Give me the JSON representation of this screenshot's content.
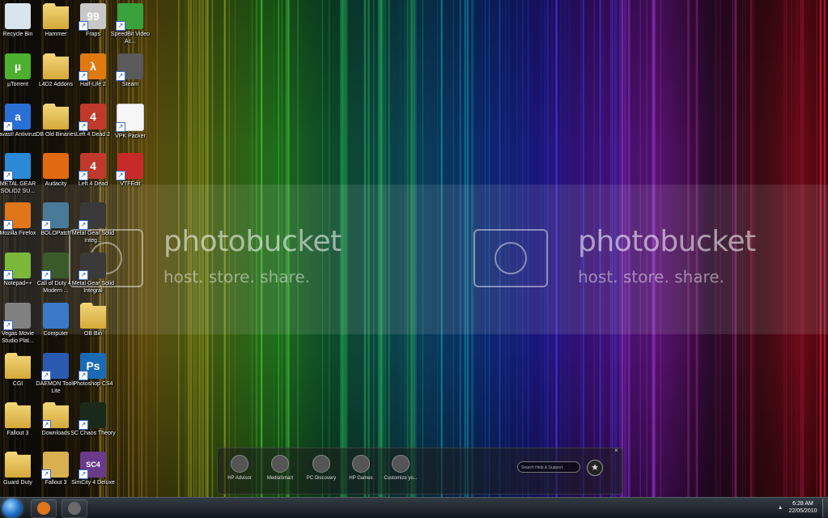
{
  "desktop": {
    "icons": [
      {
        "label": "Recycle Bin",
        "icon": "recycle-bin-icon",
        "color": "#d8e4ee",
        "shortcut": false
      },
      {
        "label": "Hammer",
        "icon": "folder-icon",
        "color": "#e8c25a",
        "shortcut": false
      },
      {
        "label": "Fraps",
        "icon": "fraps-icon",
        "color": "#c8c8c8",
        "shortcut": true,
        "glyph": "99"
      },
      {
        "label": "SpeedBit Video Ac...",
        "icon": "speedbit-icon",
        "color": "#3aa23a",
        "shortcut": true
      },
      {
        "label": "µTorrent",
        "icon": "utorrent-icon",
        "color": "#4caf2f",
        "shortcut": false,
        "glyph": "µ"
      },
      {
        "label": "L4D2 Addons",
        "icon": "folder-icon",
        "color": "#e8c25a",
        "shortcut": false
      },
      {
        "label": "Half-Life 2",
        "icon": "half-life-icon",
        "color": "#e07a10",
        "shortcut": true,
        "glyph": "λ"
      },
      {
        "label": "Steam",
        "icon": "steam-icon",
        "color": "#5a5a5a",
        "shortcut": true
      },
      {
        "label": "avast! Antivirus",
        "icon": "avast-icon",
        "color": "#2a6fd6",
        "shortcut": true,
        "glyph": "a"
      },
      {
        "label": "OB Old Binaries",
        "icon": "folder-icon",
        "color": "#e8c25a",
        "shortcut": false
      },
      {
        "label": "Left 4 Dead 2",
        "icon": "l4d2-icon",
        "color": "#c0392b",
        "shortcut": true,
        "glyph": "4"
      },
      {
        "label": "VPK Packer",
        "icon": "document-icon",
        "color": "#f4f4f4",
        "shortcut": true
      },
      {
        "label": "METAL GEAR SOLID2 SU...",
        "icon": "mgs2-icon",
        "color": "#2a8ad6",
        "shortcut": true
      },
      {
        "label": "Audacity",
        "icon": "audacity-icon",
        "color": "#e06a10",
        "shortcut": false
      },
      {
        "label": "Left 4 Dead",
        "icon": "l4d-icon",
        "color": "#c0392b",
        "shortcut": true,
        "glyph": "4"
      },
      {
        "label": "VTFEdit",
        "icon": "vtfedit-icon",
        "color": "#c82a2a",
        "shortcut": true
      },
      {
        "label": "Mozilla Firefox",
        "icon": "firefox-icon",
        "color": "#e0761a",
        "shortcut": true
      },
      {
        "label": "BOLOPatch",
        "icon": "bolopatch-icon",
        "color": "#4a7a9a",
        "shortcut": true
      },
      {
        "label": "Metal Gear Solid Integ...",
        "icon": "mgs-icon",
        "color": "#3a3a3a",
        "shortcut": true
      },
      {
        "label": "",
        "icon": "",
        "color": "",
        "shortcut": false
      },
      {
        "label": "Notepad++",
        "icon": "notepad-plus-icon",
        "color": "#7bb83a",
        "shortcut": true
      },
      {
        "label": "Call of Duty 4 - Modern ...",
        "icon": "cod4-icon",
        "color": "#3a5a2a",
        "shortcut": true
      },
      {
        "label": "Metal Gear Solid Integral",
        "icon": "mgs-icon",
        "color": "#3a3a3a",
        "shortcut": true
      },
      {
        "label": "",
        "icon": "",
        "color": "",
        "shortcut": false
      },
      {
        "label": "Vegas Movie Studio Plat...",
        "icon": "vegas-icon",
        "color": "#808080",
        "shortcut": true
      },
      {
        "label": "Computer",
        "icon": "computer-icon",
        "color": "#3a7ac8",
        "shortcut": false
      },
      {
        "label": "OB Bin",
        "icon": "folder-icon",
        "color": "#d8c490",
        "shortcut": false
      },
      {
        "label": "",
        "icon": "",
        "color": "",
        "shortcut": false
      },
      {
        "label": "CGI",
        "icon": "folder-icon",
        "color": "#e8c25a",
        "shortcut": false
      },
      {
        "label": "DAEMON Tools Lite",
        "icon": "daemon-tools-icon",
        "color": "#2a5ab0",
        "shortcut": true
      },
      {
        "label": "Photoshop CS4",
        "icon": "photoshop-icon",
        "color": "#1a6ab4",
        "shortcut": true,
        "glyph": "Ps"
      },
      {
        "label": "",
        "icon": "",
        "color": "",
        "shortcut": false
      },
      {
        "label": "Fallout 3",
        "icon": "folder-icon",
        "color": "#e8c25a",
        "shortcut": false
      },
      {
        "label": "Downloads",
        "icon": "downloads-folder-icon",
        "color": "#e8c25a",
        "shortcut": true
      },
      {
        "label": "SC Chaos Theory",
        "icon": "splinter-cell-icon",
        "color": "#1a2a1a",
        "shortcut": true
      },
      {
        "label": "",
        "icon": "",
        "color": "",
        "shortcut": false
      },
      {
        "label": "Guard Duty",
        "icon": "folder-icon",
        "color": "#e8c25a",
        "shortcut": false
      },
      {
        "label": "Fallout 3",
        "icon": "fallout-icon",
        "color": "#d8b050",
        "shortcut": true
      },
      {
        "label": "SimCity 4 Deluxe",
        "icon": "simcity-icon",
        "color": "#6a3a8a",
        "shortcut": true,
        "glyph": "SC4"
      }
    ]
  },
  "watermark": {
    "title": "photobucket",
    "subtitle": "host. store. share."
  },
  "gadget": {
    "items": [
      {
        "label": "HP Advisor",
        "icon": "hp-advisor-icon"
      },
      {
        "label": "MediaSmart",
        "icon": "mediasmart-icon"
      },
      {
        "label": "PC Discovery",
        "icon": "pc-discovery-icon"
      },
      {
        "label": "HP Games",
        "icon": "hp-games-icon"
      },
      {
        "label": "Customize yo...",
        "icon": "customize-icon"
      }
    ],
    "search_placeholder": "Search Help & Support",
    "star": "★",
    "close": "×"
  },
  "taskbar": {
    "pinned": [
      {
        "name": "firefox",
        "icon": "firefox-icon",
        "color": "#e0761a"
      },
      {
        "name": "steam",
        "icon": "steam-icon",
        "color": "#6a6a6a"
      }
    ],
    "tray_arrow": "▴",
    "time": "6:28 AM",
    "date": "22/05/2010"
  }
}
